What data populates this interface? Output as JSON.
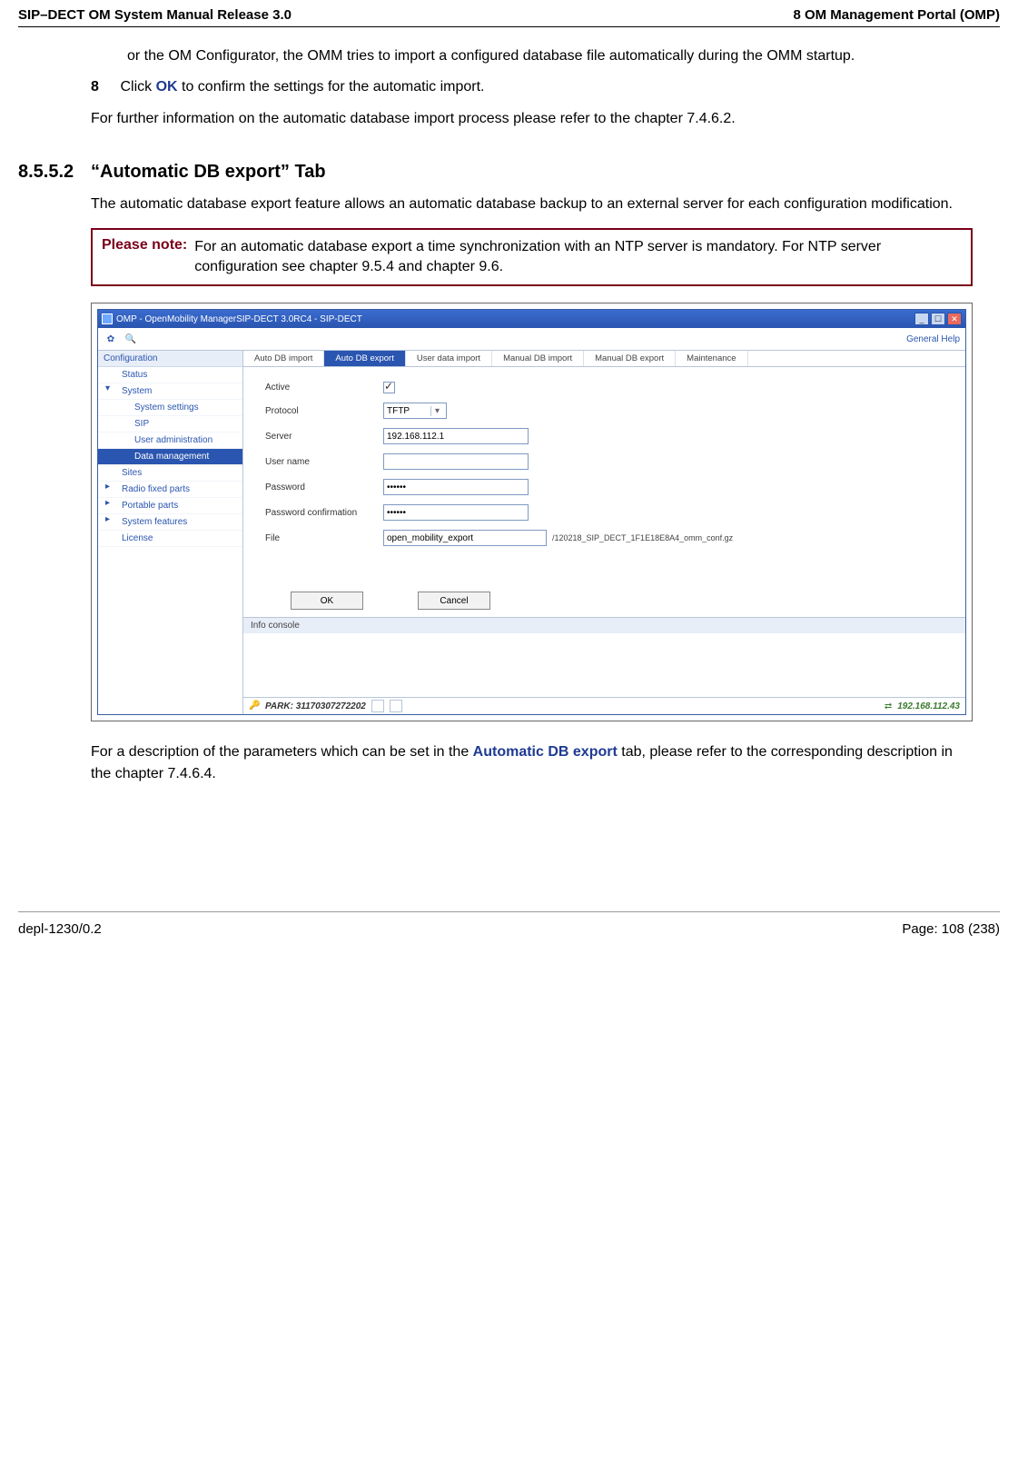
{
  "header": {
    "left": "SIP–DECT OM System Manual Release 3.0",
    "right": "8 OM Management Portal (OMP)"
  },
  "body": {
    "para1": "or the OM Configurator, the OMM tries to import a configured database file automatically during the OMM startup.",
    "step8_num": "8",
    "step8_a": "Click ",
    "step8_ok": "OK",
    "step8_b": " to confirm the settings for the automatic import.",
    "para2": "For further information on the automatic database import process please refer to the chapter 7.4.6.2.",
    "section_num": "8.5.5.2",
    "section_title": "“Automatic DB export” Tab",
    "para3": "The automatic database export feature allows an automatic database backup to an external server for each configuration modification.",
    "note_label": "Please note:",
    "note_text": "For an automatic database export a time synchronization with an NTP server is mandatory. For NTP server configuration see chapter 9.5.4 and chapter 9.6.",
    "para4_a": "For a description of the parameters which can be set in the ",
    "para4_bold": "Automatic DB export",
    "para4_b": " tab, please refer to the corresponding description in the chapter 7.4.6.4."
  },
  "screenshot": {
    "title": "OMP - OpenMobility ManagerSIP-DECT 3.0RC4 - SIP-DECT",
    "toolbar_links": "General   Help",
    "sidebar": {
      "heading": "Configuration",
      "items": [
        {
          "label": "Status"
        },
        {
          "label": "System",
          "arrow": true
        },
        {
          "label": "System settings",
          "sub": true
        },
        {
          "label": "SIP",
          "sub": true
        },
        {
          "label": "User administration",
          "sub": true
        },
        {
          "label": "Data management",
          "sub": true,
          "active": true
        },
        {
          "label": "Sites"
        },
        {
          "label": "Radio fixed parts",
          "arrow_right": true
        },
        {
          "label": "Portable parts",
          "arrow_right": true
        },
        {
          "label": "System features",
          "arrow_right": true
        },
        {
          "label": "License"
        }
      ]
    },
    "tabs": [
      "Auto DB import",
      "Auto DB export",
      "User data import",
      "Manual DB import",
      "Manual DB export",
      "Maintenance"
    ],
    "active_tab_index": 1,
    "form": {
      "active_label": "Active",
      "protocol_label": "Protocol",
      "protocol_value": "TFTP",
      "server_label": "Server",
      "server_value": "192.168.112.1",
      "user_label": "User name",
      "user_value": "",
      "password_label": "Password",
      "password_value": "••••••",
      "password2_label": "Password confirmation",
      "password2_value": "••••••",
      "file_label": "File",
      "file_value": "open_mobility_export",
      "file_suffix": "/120218_SIP_DECT_1F1E18E8A4_omm_conf.gz",
      "ok_btn": "OK",
      "cancel_btn": "Cancel"
    },
    "info_console": "Info console",
    "status": {
      "park": "PARK: 31170307272202",
      "ip": "192.168.112.43"
    }
  },
  "footer": {
    "left": "depl-1230/0.2",
    "right": "Page: 108 (238)"
  }
}
